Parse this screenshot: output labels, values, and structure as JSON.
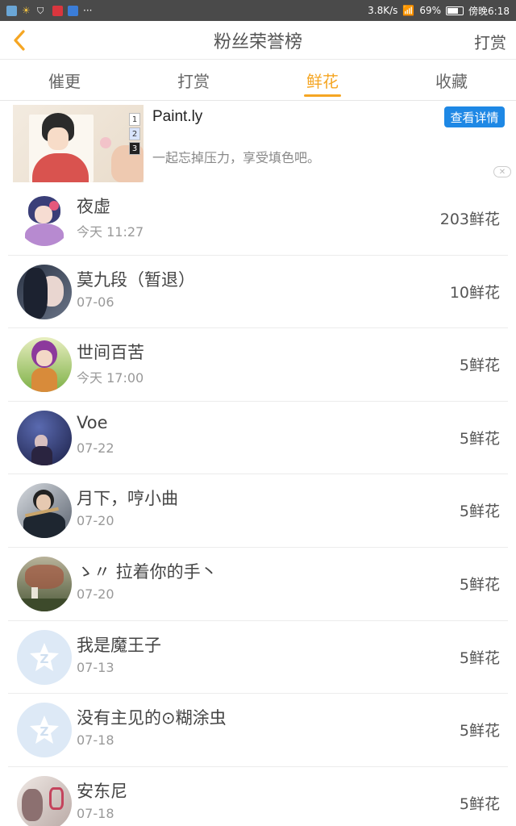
{
  "status_bar": {
    "net_speed": "3.8K/s",
    "battery": "69%",
    "time": "傍晚6:18"
  },
  "header": {
    "title": "粉丝荣誉榜",
    "action": "打赏"
  },
  "tabs": [
    {
      "label": "催更",
      "active": false
    },
    {
      "label": "打赏",
      "active": false
    },
    {
      "label": "鲜花",
      "active": true
    },
    {
      "label": "收藏",
      "active": false
    }
  ],
  "ad": {
    "title": "Paint.ly",
    "desc": "一起忘掉压力，享受填色吧。",
    "button": "查看详情",
    "number_tiles": [
      "1",
      "2",
      "3"
    ]
  },
  "list": [
    {
      "name": "夜虚",
      "date": "今天 11:27",
      "count": "203鲜花"
    },
    {
      "name": "莫九段（暂退）",
      "date": "07-06",
      "count": "10鲜花"
    },
    {
      "name": "世间百苦",
      "date": "今天 17:00",
      "count": "5鲜花"
    },
    {
      "name": "Voe",
      "date": "07-22",
      "count": "5鲜花"
    },
    {
      "name": "月下，哼小曲",
      "date": "07-20",
      "count": "5鲜花"
    },
    {
      "name": "ゝ〃 拉着你的手丶",
      "date": "07-20",
      "count": "5鲜花"
    },
    {
      "name": "我是魔王子",
      "date": "07-13",
      "count": "5鲜花"
    },
    {
      "name": "没有主见的⊙糊涂虫",
      "date": "07-18",
      "count": "5鲜花"
    },
    {
      "name": "安东尼",
      "date": "07-18",
      "count": "5鲜花"
    }
  ],
  "colors": {
    "accent": "#f5a623",
    "ad_button": "#1e88e5"
  }
}
